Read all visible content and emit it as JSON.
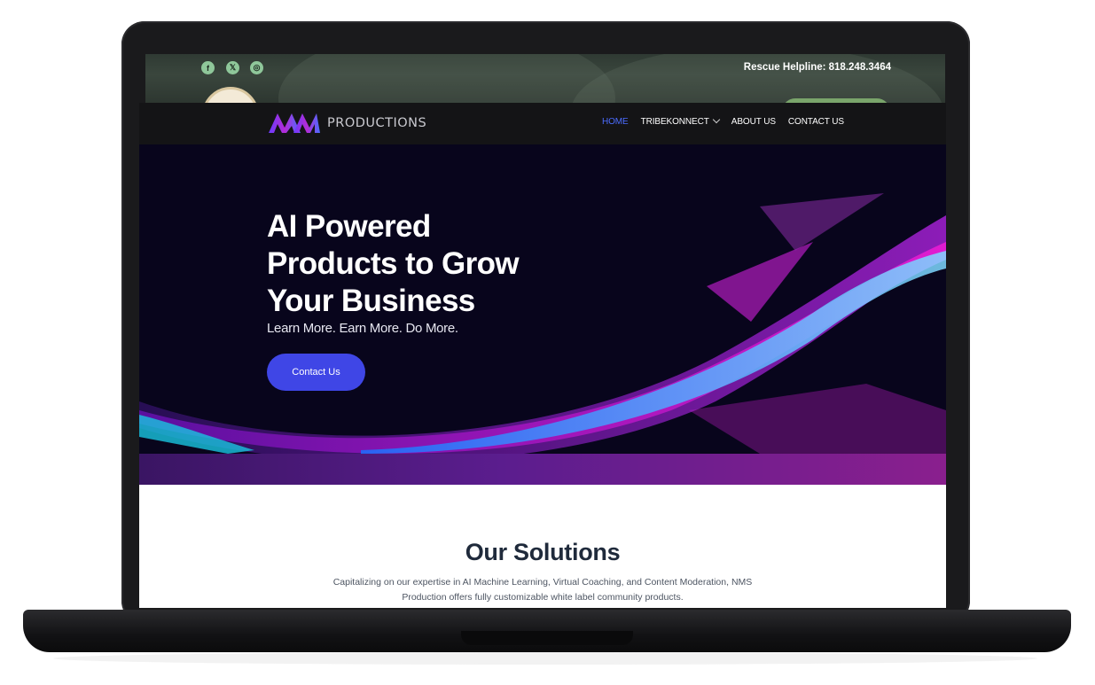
{
  "background_site": {
    "social_icons": [
      "facebook-icon",
      "x-icon",
      "instagram-icon"
    ],
    "social_glyphs": [
      "f",
      "𝕏",
      "◎"
    ],
    "helpline": "Rescue Helpline: 818.248.3464"
  },
  "header": {
    "logo_text": "PRODUCTIONS",
    "nav": [
      {
        "label": "HOME",
        "active": true
      },
      {
        "label": "TRIBEKONNECT",
        "has_dropdown": true
      },
      {
        "label": "ABOUT US"
      },
      {
        "label": "CONTACT US"
      }
    ]
  },
  "hero": {
    "title_lines": [
      "AI Powered",
      "Products to Grow",
      "Your Business"
    ],
    "subtitle": "Learn More. Earn More. Do More.",
    "cta_label": "Contact Us"
  },
  "solutions": {
    "title": "Our Solutions",
    "description": "Capitalizing on our expertise in AI Machine Learning, Virtual Coaching, and Content Moderation, NMS Production offers fully customizable white label community products."
  },
  "colors": {
    "accent": "#3f46e6",
    "nav_active": "#4b6cff",
    "band_start": "#3a1563",
    "band_end": "#8a1f8e"
  }
}
